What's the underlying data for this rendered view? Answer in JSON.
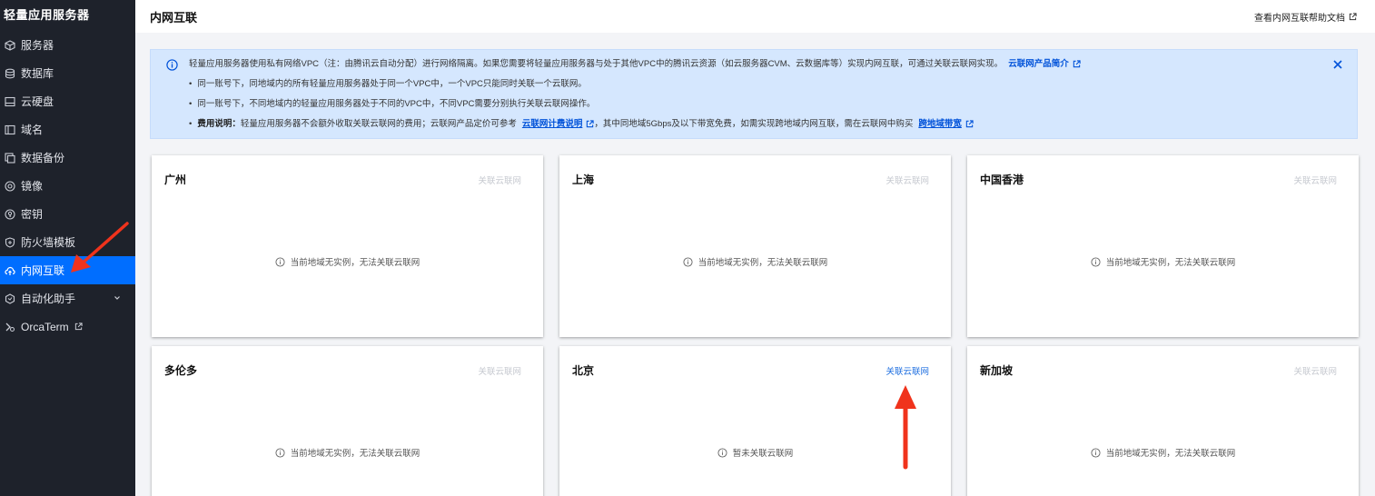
{
  "sidebar": {
    "brand": "轻量应用服务器",
    "items": [
      {
        "label": "服务器",
        "icon": "server-icon"
      },
      {
        "label": "数据库",
        "icon": "database-icon"
      },
      {
        "label": "云硬盘",
        "icon": "disk-icon"
      },
      {
        "label": "域名",
        "icon": "domain-icon"
      },
      {
        "label": "数据备份",
        "icon": "backup-icon"
      },
      {
        "label": "镜像",
        "icon": "image-icon"
      },
      {
        "label": "密钥",
        "icon": "key-icon"
      },
      {
        "label": "防火墙模板",
        "icon": "firewall-icon"
      },
      {
        "label": "内网互联",
        "icon": "network-icon",
        "active": true
      },
      {
        "label": "自动化助手",
        "icon": "automation-icon",
        "expandable": true
      },
      {
        "label": "OrcaTerm",
        "icon": "terminal-icon",
        "external": true
      }
    ]
  },
  "header": {
    "title": "内网互联",
    "help_link": "查看内网互联帮助文档"
  },
  "notice": {
    "main_text": "轻量应用服务器使用私有网络VPC（注：由腾讯云自动分配）进行网络隔离。如果您需要将轻量应用服务器与处于其他VPC中的腾讯云资源（如云服务器CVM、云数据库等）实现内网互联，可通过关联云联网实现。",
    "main_link": "云联网产品简介",
    "bullet1": "同一账号下，同地域内的所有轻量应用服务器处于同一个VPC中，一个VPC只能同时关联一个云联网。",
    "bullet2": "同一账号下，不同地域内的轻量应用服务器处于不同的VPC中，不同VPC需要分别执行关联云联网操作。",
    "fee_label": "费用说明：",
    "fee_text1": "轻量应用服务器不会额外收取关联云联网的费用；云联网产品定价可参考",
    "fee_link1": "云联网计费说明",
    "fee_text2": "，其中同地域5Gbps及以下带宽免费，如需实现跨地域内网互联，需在云联网中购买",
    "fee_link2": "跨地域带宽"
  },
  "regions": [
    {
      "name": "广州",
      "action": "关联云联网",
      "enabled": false,
      "status": "当前地域无实例，无法关联云联网"
    },
    {
      "name": "上海",
      "action": "关联云联网",
      "enabled": false,
      "status": "当前地域无实例，无法关联云联网"
    },
    {
      "name": "中国香港",
      "action": "关联云联网",
      "enabled": false,
      "status": "当前地域无实例，无法关联云联网"
    },
    {
      "name": "多伦多",
      "action": "关联云联网",
      "enabled": false,
      "status": "当前地域无实例，无法关联云联网"
    },
    {
      "name": "北京",
      "action": "关联云联网",
      "enabled": true,
      "status": "暂未关联云联网"
    },
    {
      "name": "新加坡",
      "action": "关联云联网",
      "enabled": false,
      "status": "当前地域无实例，无法关联云联网"
    }
  ],
  "colors": {
    "sidebar_bg": "#1e222b",
    "active_item": "#006eff",
    "link": "#0052d9",
    "notice_bg": "#d5e7fe",
    "annotation_arrow": "#f0331c"
  }
}
